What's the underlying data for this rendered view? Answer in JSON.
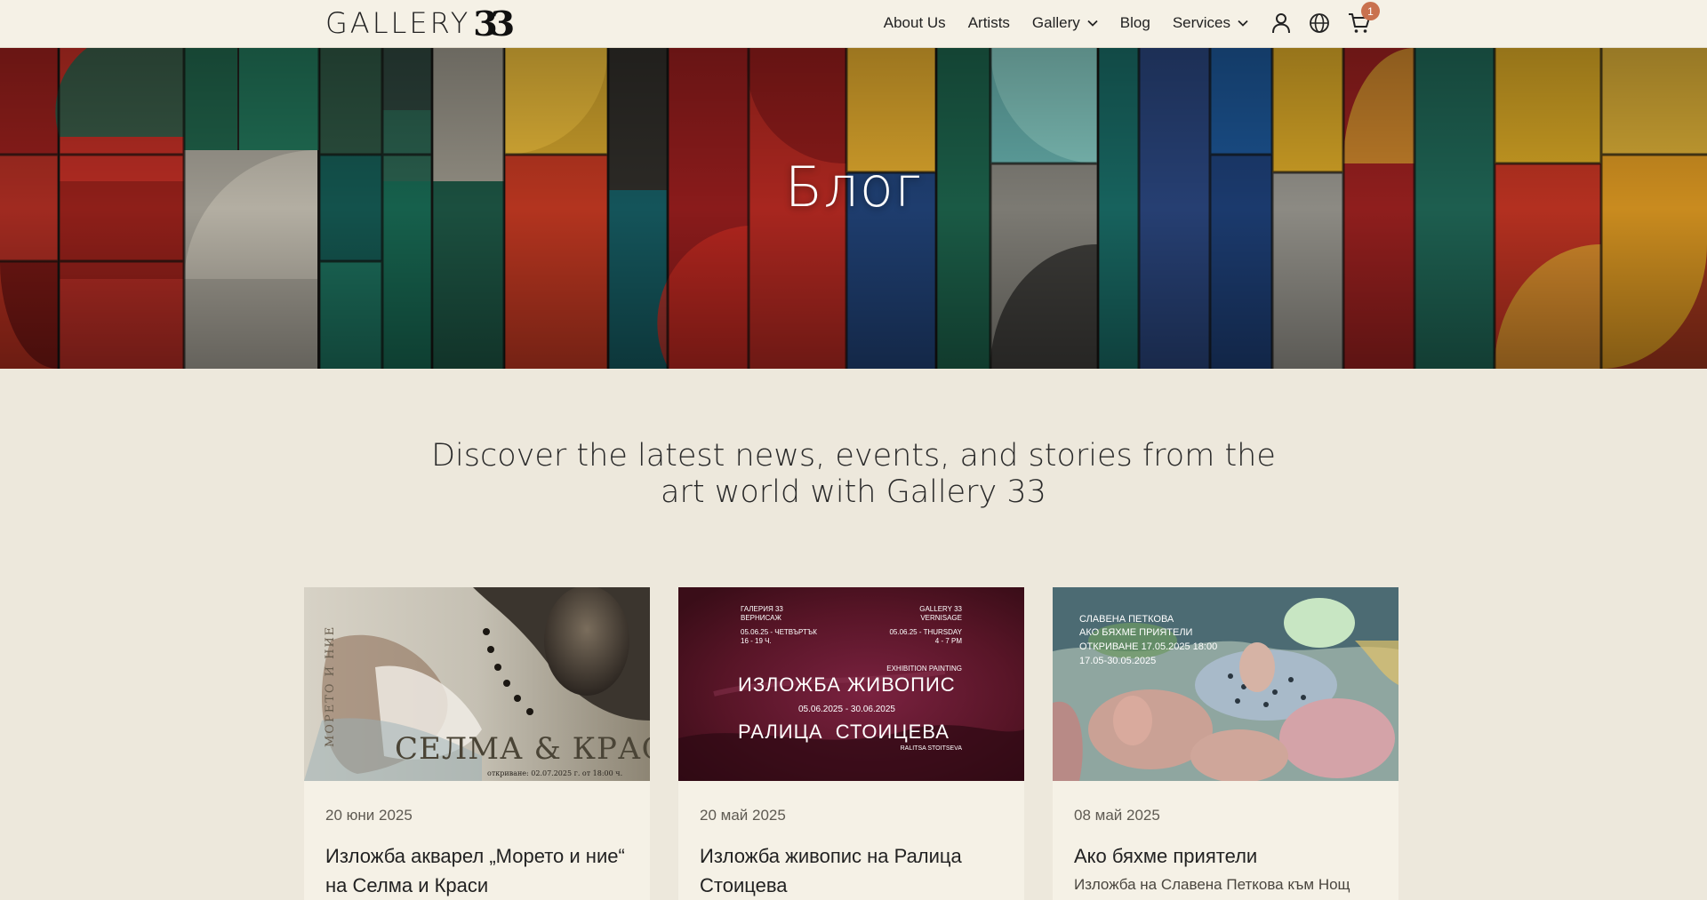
{
  "header": {
    "logo_word": "GALLERY",
    "logo_number": "33",
    "nav": [
      {
        "label": "About Us"
      },
      {
        "label": "Artists"
      },
      {
        "label": "Gallery"
      },
      {
        "label": "Blog"
      },
      {
        "label": "Services"
      }
    ],
    "icons": [
      "user-icon",
      "globe-icon",
      "cart-icon"
    ],
    "cart_count": "1"
  },
  "hero": {
    "title": "Блог"
  },
  "intro": {
    "text": "Discover the latest news, events, and stories from the art world with Gallery 33"
  },
  "cards": [
    {
      "date": "20 юни 2025",
      "title": "Изложба акварел „Морето и ние“ на Селма и Краси",
      "image_text": {
        "title": "СЕЛМА & КРАСИ",
        "vertical": "МОРЕТО И НИЕ",
        "opening": "откриване: 02.07.2025 г. от 18:00 ч."
      }
    },
    {
      "date": "20 май 2025",
      "title": "Изложба живопис на Ралица Стоицева",
      "image_text": {
        "left_top": "ГАЛЕРИЯ 33",
        "left_sub": "ВЕРНИСАЖ",
        "left_date": "05.06.25 - ЧЕТВЪРТЪК",
        "left_time": "16 - 19 Ч.",
        "right_top": "GALLERY 33",
        "right_sub": "VERNISAGE",
        "right_date": "05.06.25 - THURSDAY",
        "right_time": "4 - 7 PM",
        "small_label": "EXHIBITION PAINTING",
        "main": "ИЗЛОЖБА ЖИВОПИС",
        "range": "05.06.2025 - 30.06.2025",
        "artist": "РАЛИЦА  СТОИЦЕВА",
        "artist_latin": "RALITSA STOITSEVA"
      }
    },
    {
      "date": "08 май 2025",
      "title": "Ако бяхме приятели",
      "subtitle": "Изложба на Славена Петкова към Нощ",
      "image_text": {
        "line1": "СЛАВЕНА ПЕТКОВА",
        "line2": "АКО БЯХМЕ ПРИЯТЕЛИ",
        "line3": "ОТКРИВАНЕ 17.05.2025 18:00",
        "line4": "17.05-30.05.2025"
      }
    }
  ],
  "colors": {
    "page_bg": "#ede8dc",
    "header_bg": "#f5f1e6",
    "card_bg": "#f5f1e6",
    "badge": "#c9714e"
  }
}
